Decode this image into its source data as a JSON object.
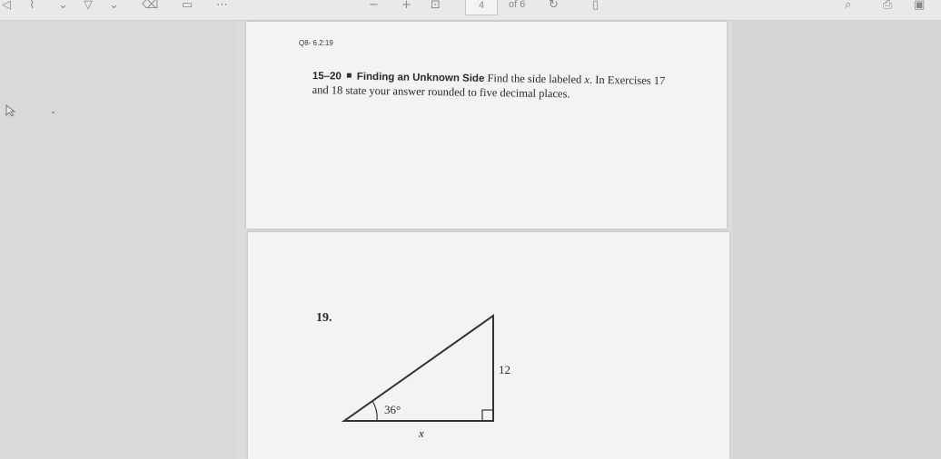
{
  "toolbar": {
    "page_number": "4",
    "page_total_label": "of 6"
  },
  "document": {
    "question_id": "Q8- 6.2:19",
    "problem_range": "15–20",
    "problem_heading": "Finding an Unknown Side",
    "problem_text_1": "Find the side labeled ",
    "problem_var": "x",
    "problem_text_2": ". In Exercises 17 and 18 state your answer rounded to five decimal places.",
    "exercise_number": "19.",
    "figure": {
      "angle_label": "36°",
      "side_label": "12",
      "base_label": "x"
    }
  }
}
